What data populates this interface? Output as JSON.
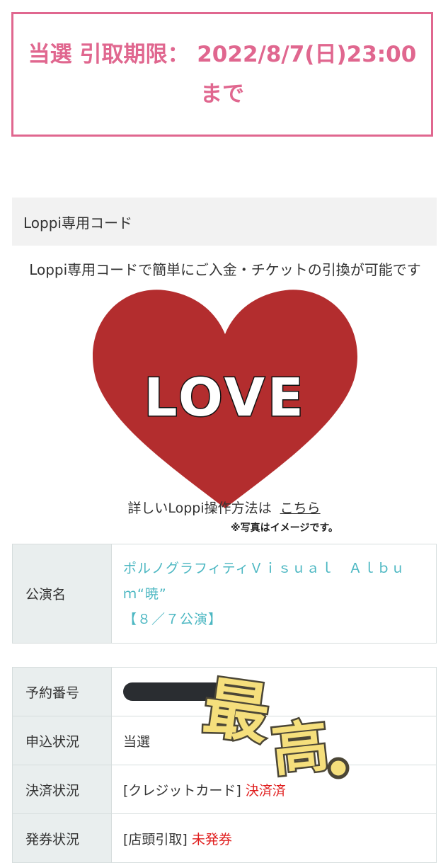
{
  "notice": {
    "line1": "当選 引取期限： 2022/8/7(日)23:00",
    "line2": "まで"
  },
  "loppi": {
    "header": "Loppi専用コード",
    "description": "Loppi専用コードで簡単にご入金・チケットの引換が可能です",
    "howto_text": "詳しいLoppi操作方法は",
    "howto_link": "こちら"
  },
  "overlay": {
    "heart_text": "LOVE",
    "photo_note": "※写真はイメージです。",
    "sticker_text": "最高。",
    "heart_color": "#b32d2e",
    "sticker_color": "#f5df7c"
  },
  "show": {
    "label": "公演名",
    "name_line1": "ポルノグラフィティＶｉｓｕａｌ　Ａｌｂｕ",
    "name_line2": "ｍ“暁”",
    "date": "【８／７公演】"
  },
  "reservation": {
    "rows": [
      {
        "label": "予約番号",
        "value": ""
      },
      {
        "label": "申込状況",
        "value": "当選"
      },
      {
        "label": "決済状況",
        "prefix": "[クレジットカード]",
        "status": "決済済"
      },
      {
        "label": "発券状況",
        "prefix": "[店頭引取]",
        "status": "未発券"
      }
    ]
  },
  "colors": {
    "accent_pink": "#e0678f",
    "link_teal": "#4cb7c2",
    "status_red": "#e01e1e"
  }
}
